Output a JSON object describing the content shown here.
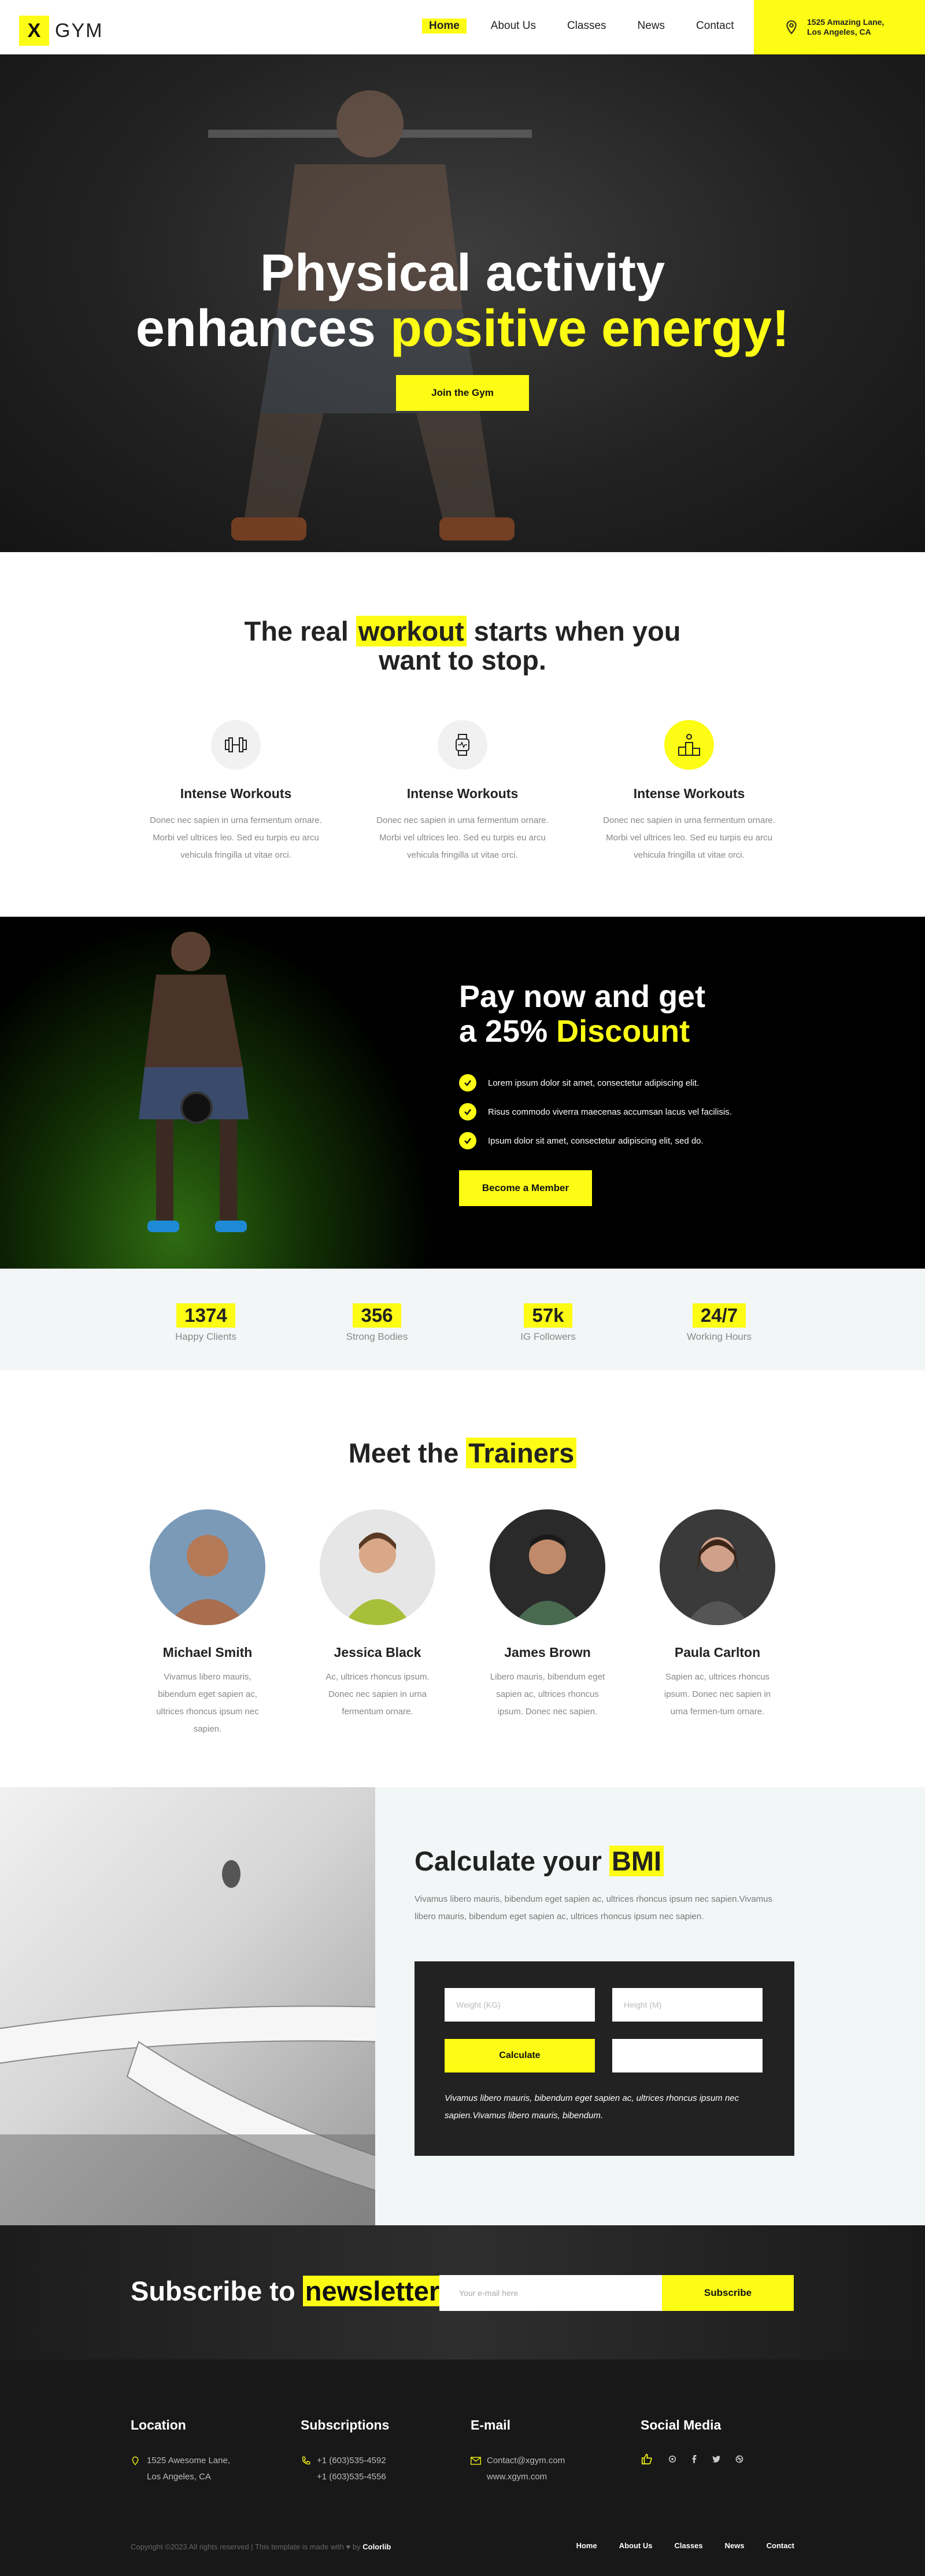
{
  "brand": {
    "logo_letter": "X",
    "logo_text": "GYM"
  },
  "nav": {
    "items": [
      {
        "label": "Home",
        "active": true
      },
      {
        "label": "About Us"
      },
      {
        "label": "Classes"
      },
      {
        "label": "News"
      },
      {
        "label": "Contact"
      }
    ],
    "address_line1": "1525 Amazing Lane,",
    "address_line2": "Los Angeles, CA"
  },
  "hero": {
    "line1": "Physical activity",
    "line2_plain": "enhances ",
    "line2_highlight": "positive energy!",
    "cta": "Join the Gym"
  },
  "workout": {
    "title_pre": "The real ",
    "title_highlight": "workout",
    "title_post": " starts when you",
    "title_line2": "want to stop.",
    "features": [
      {
        "icon": "dumbbell-icon",
        "title": "Intense Workouts",
        "text": "Donec nec sapien in urna fermentum ornare. Morbi vel ultrices leo. Sed eu turpis eu arcu vehicula fringilla ut vitae orci."
      },
      {
        "icon": "smartwatch-icon",
        "title": "Intense Workouts",
        "text": "Donec nec sapien in urna fermentum ornare. Morbi vel ultrices leo. Sed eu turpis eu arcu vehicula fringilla ut vitae orci."
      },
      {
        "icon": "podium-icon",
        "title": "Intense Workouts",
        "text": "Donec nec sapien in urna fermentum ornare. Morbi vel ultrices leo. Sed eu turpis eu arcu vehicula fringilla ut vitae orci."
      }
    ]
  },
  "discount": {
    "title_line1": "Pay now and get",
    "title_line2_plain": "a 25% ",
    "title_line2_highlight": "Discount",
    "checks": [
      "Lorem ipsum dolor sit amet, consectetur adipiscing elit.",
      "Risus commodo viverra maecenas accumsan lacus vel facilisis.",
      "Ipsum dolor sit amet, consectetur adipiscing elit, sed do."
    ],
    "cta": "Become a Member"
  },
  "stats": [
    {
      "value": "1374",
      "label": "Happy Clients"
    },
    {
      "value": "356",
      "label": "Strong Bodies"
    },
    {
      "value": "57k",
      "label": "IG Followers"
    },
    {
      "value": "24/7",
      "label": "Working Hours"
    }
  ],
  "trainers": {
    "title_pre": "Meet the ",
    "title_highlight": "Trainers",
    "items": [
      {
        "name": "Michael Smith",
        "text": "Vivamus libero mauris, bibendum eget sapien ac, ultrices rhoncus ipsum nec sapien."
      },
      {
        "name": "Jessica Black",
        "text": "Ac, ultrices rhoncus ipsum. Donec nec sapien in urna fermentum ornare."
      },
      {
        "name": "James Brown",
        "text": "Libero mauris, bibendum eget sapien ac, ultrices rhoncus ipsum. Donec nec sapien."
      },
      {
        "name": "Paula Carlton",
        "text": "Sapien ac, ultrices rhoncus ipsum. Donec nec sapien in urna fermen-tum ornare."
      }
    ]
  },
  "bmi": {
    "title_pre": "Calculate your ",
    "title_highlight": "BMI",
    "desc": "Vivamus libero mauris, bibendum eget sapien ac, ultrices rhoncus ipsum nec sapien.Vivamus libero mauris, bibendum eget sapien ac, ultrices rhoncus ipsum nec sapien.",
    "weight_placeholder": "Weight (KG)",
    "height_placeholder": "Height (M)",
    "calculate": "Calculate",
    "note": "Vivamus libero mauris, bibendum eget sapien ac, ultrices rhoncus ipsum nec sapien.Vivamus libero mauris, bibendum."
  },
  "subscribe": {
    "title_pre": "Subscribe to ",
    "title_highlight": "newsletter",
    "placeholder": "Your e-mail here",
    "button": "Subscribe"
  },
  "footer": {
    "location_title": "Location",
    "location_line1": "1525 Awesome Lane,",
    "location_line2": "Los Angeles, CA",
    "subs_title": "Subscriptions",
    "phone1": "+1 (603)535-4592",
    "phone2": "+1 (603)535-4556",
    "email_title": "E-mail",
    "email": "Contact@xgym.com",
    "website": "www.xgym.com",
    "social_title": "Social Media",
    "copyright_text": "Copyright ©2023 All rights reserved | This template is made with ♥ by ",
    "copyright_brand": "Colorlib",
    "menu": [
      "Home",
      "About Us",
      "Classes",
      "News",
      "Contact"
    ]
  },
  "colors": {
    "accent": "#fcfc14",
    "dark": "#222222",
    "light_bg": "#f3f6f7"
  }
}
